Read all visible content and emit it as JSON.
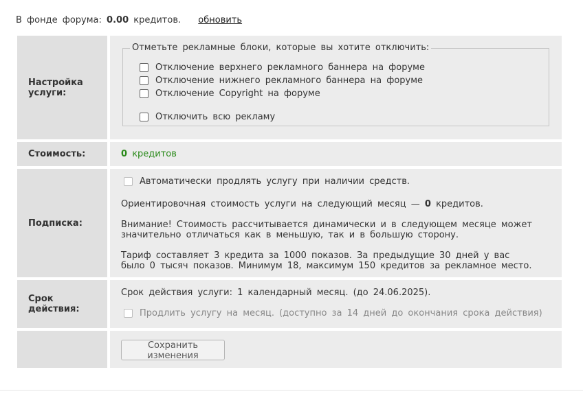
{
  "balance": {
    "prefix": "В фонде форума:",
    "amount": "0.00",
    "suffix": "кредитов.",
    "refresh_link": "обновить"
  },
  "rows": {
    "settings": {
      "label": "Настройка услуги:",
      "legend": "Отметьте рекламные блоки, которые вы хотите отключить:",
      "options": [
        "Отключение верхнего рекламного баннера на форуме",
        "Отключение нижнего рекламного баннера на форуме",
        "Отключение Copyright на форуме",
        "Отключить всю рекламу"
      ]
    },
    "cost": {
      "label": "Стоимость:",
      "amount": "0",
      "unit": "кредитов"
    },
    "subscription": {
      "label": "Подписка:",
      "auto_renew": "Автоматически продлять услугу при наличии средств.",
      "estimate_prefix": "Ориентировочная стоимость услуги на следующий месяц —",
      "estimate_amount": "0",
      "estimate_suffix": "кредитов.",
      "warning": "Внимание! Стоимость рассчитывается динамически и в следующем месяце может значительно отличаться как в меньшую, так и в большую сторону.",
      "tariff": "Тариф составляет 3 кредита за 1000 показов. За предыдущие 30 дней у вас было 0 тысяч показов. Минимум 18, максимум 150 кредитов за рекламное место."
    },
    "duration": {
      "label": "Срок действия:",
      "text": "Срок действия услуги: 1 календарный месяц. (до 24.06.2025).",
      "extend": "Продлить услугу на месяц. (доступно за 14 дней до окончания срока действия)"
    },
    "actions": {
      "save_label": "Сохранить изменения"
    }
  }
}
